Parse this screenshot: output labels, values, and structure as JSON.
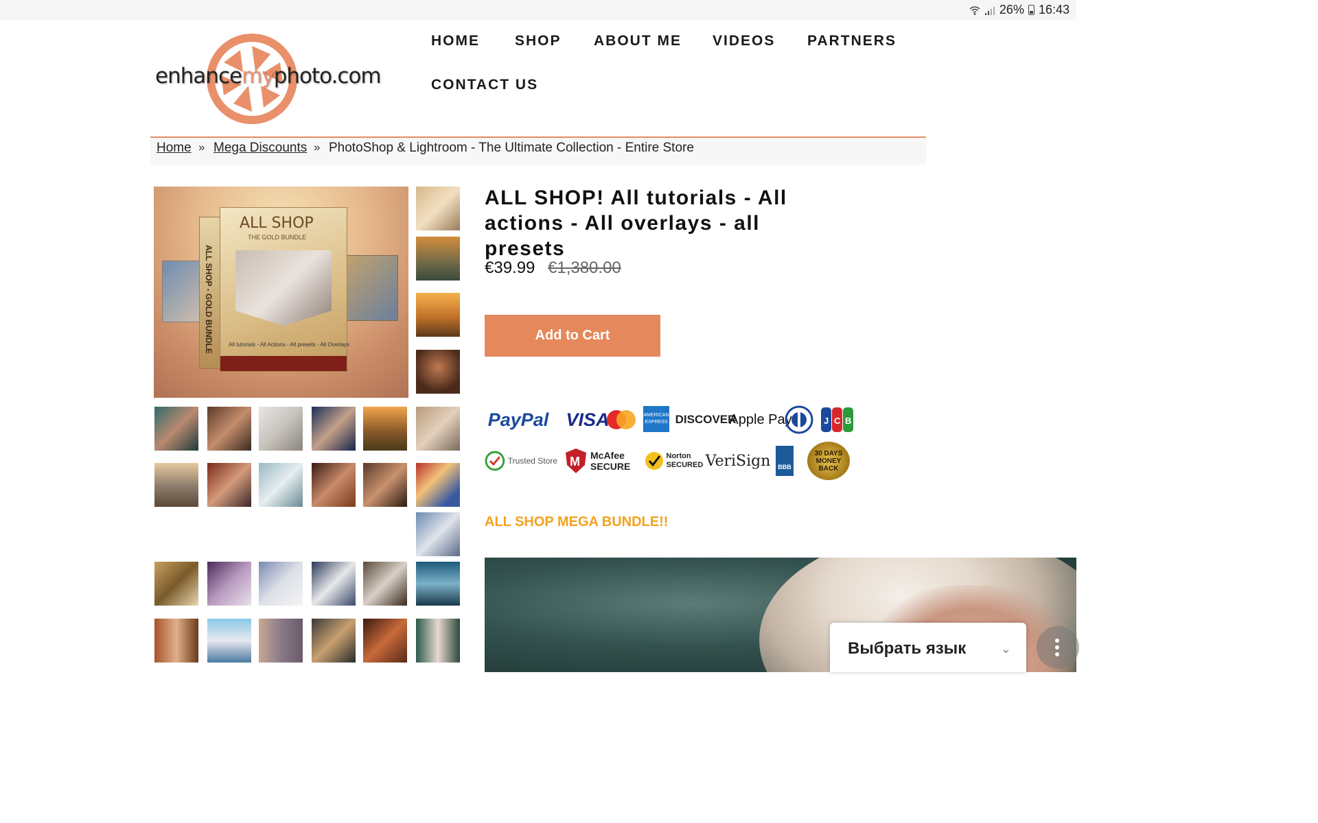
{
  "status_bar": {
    "battery": "26%",
    "time": "16:43"
  },
  "logo": {
    "text_pre": "enhance",
    "text_my": "my",
    "text_post": "photo.com"
  },
  "nav": {
    "items": [
      "HOME",
      "SHOP",
      "ABOUT ME",
      "VIDEOS",
      "PARTNERS",
      "CONTACT US"
    ]
  },
  "breadcrumb": {
    "items": [
      "Home",
      "Mega Discounts",
      "PhotoShop & Lightroom - The Ultimate Collection - Entire Store"
    ],
    "separator": "»"
  },
  "product_image": {
    "box_title": "ALL SHOP",
    "box_subtitle": "THE GOLD BUNDLE",
    "box_side_text": "ALL SHOP - GOLD BUNDLE",
    "box_caption": "All tutorials - All Actions - All presets - All Overlays"
  },
  "product": {
    "title": "ALL SHOP! All tutorials - All actions - All overlays - all presets",
    "price": "€39.99",
    "old_price": "€1,380.00",
    "add_to_cart": "Add to Cart",
    "promo": "ALL SHOP MEGA BUNDLE!!"
  },
  "payment_logos": [
    "PayPal",
    "VISA",
    "mastercard",
    "AMERICAN EXPRESS",
    "DISCOVER",
    "Apple Pay",
    "Diners Club",
    "JCB"
  ],
  "trust_badges": [
    "Trusted Store",
    "McAfee SECURE",
    "Norton SECURED",
    "VeriSign",
    "BBB",
    "30 DAYS MONEY BACK"
  ],
  "language_widget": {
    "label": "Выбрать язык"
  },
  "colors": {
    "accent": "#e5885b",
    "promo": "#f2a21e",
    "crumb_border": "#e58a64"
  }
}
